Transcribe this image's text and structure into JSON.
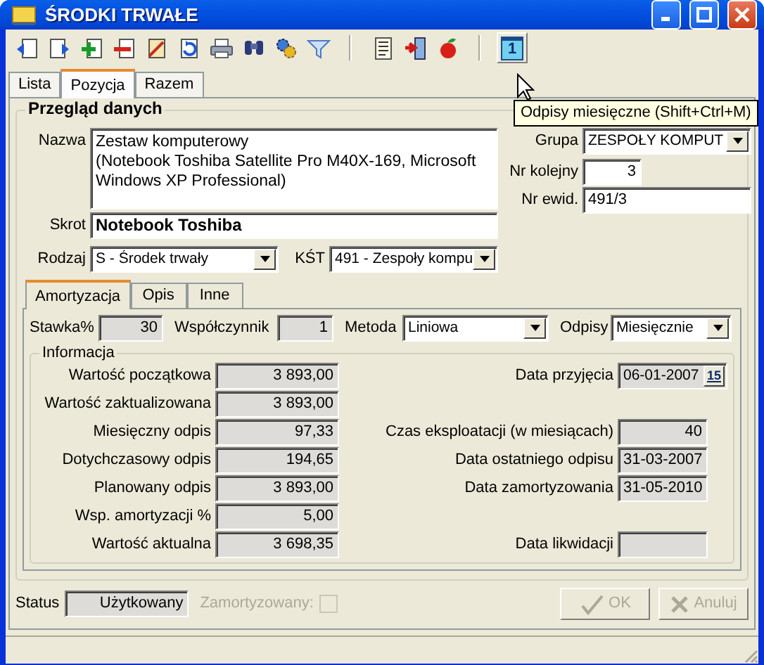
{
  "window": {
    "title": "ŚRODKI TRWAŁE"
  },
  "toolbar": {
    "groups": [
      [
        {
          "hot": false
        },
        {
          "hot": false
        },
        {
          "hot": false
        },
        {
          "hot": false
        },
        {
          "hot": false
        },
        {
          "hot": false
        },
        {
          "hot": false
        },
        {
          "hot": false
        },
        {
          "hot": false
        },
        {
          "hot": false
        }
      ],
      [
        {
          "hot": false
        },
        {
          "hot": false
        },
        {
          "hot": false
        }
      ],
      [
        {
          "hot": true,
          "label": "1"
        }
      ]
    ]
  },
  "tooltip": "Odpisy miesięczne (Shift+Ctrl+M)",
  "tabs": [
    {
      "label": "Lista",
      "selected": false
    },
    {
      "label": "Pozycja",
      "selected": true
    },
    {
      "label": "Razem",
      "selected": false
    }
  ],
  "overview": {
    "title": "Przegląd danych",
    "nazwa": {
      "label": "Nazwa",
      "value": "Zestaw komputerowy\n(Notebook Toshiba Satellite Pro M40X-169, Microsoft Windows XP Professional)"
    },
    "skrot": {
      "label": "Skrot",
      "value": "Notebook Toshiba"
    },
    "rodzaj": {
      "label": "Rodzaj",
      "value": "S - Środek trwały"
    },
    "kst": {
      "label": "KŚT",
      "value": "491 - Zespoły kompu"
    },
    "grupa": {
      "label": "Grupa",
      "value": "ZESPOŁY KOMPUT"
    },
    "nr_kolejny": {
      "label": "Nr kolejny",
      "value": "3"
    },
    "nr_ewid": {
      "label": "Nr ewid.",
      "value": "491/3"
    }
  },
  "subtabs": [
    {
      "label": "Amortyzacja",
      "selected": true
    },
    {
      "label": "Opis",
      "selected": false
    },
    {
      "label": "Inne",
      "selected": false
    }
  ],
  "params": [
    {
      "kind": "number",
      "label": "Stawka%",
      "value": "30"
    },
    {
      "kind": "number",
      "label": "Współczynnik",
      "value": "1"
    },
    {
      "kind": "combo",
      "label": "Metoda",
      "value": "Liniowa"
    },
    {
      "kind": "combo",
      "label": "Odpisy",
      "value": "Miesięcznie"
    }
  ],
  "info": {
    "title": "Informacja",
    "rows": [
      {
        "left": {
          "label": "Wartość początkowa",
          "value": "3 893,00"
        },
        "right": {
          "kind": "date",
          "label": "Data przyjęcia",
          "value": "06-01-2007",
          "button": "15"
        }
      },
      {
        "left": {
          "label": "Wartość zaktualizowana",
          "value": "3 893,00"
        }
      },
      {
        "left": {
          "label": "Miesięczny odpis",
          "value": "97,33"
        },
        "right": {
          "kind": "number",
          "label": "Czas eksploatacji (w miesiącach)",
          "value": "40"
        }
      },
      {
        "left": {
          "label": "Dotychczasowy odpis",
          "value": "194,65"
        },
        "right": {
          "kind": "text",
          "label": "Data ostatniego odpisu",
          "value": "31-03-2007"
        }
      },
      {
        "left": {
          "label": "Planowany odpis",
          "value": "3 893,00"
        },
        "right": {
          "kind": "text",
          "label": "Data zamortyzowania",
          "value": "31-05-2010"
        }
      },
      {
        "left": {
          "label": "Wsp. amortyzacji %",
          "value": "5,00"
        }
      },
      {
        "left": {
          "label": "Wartość aktualna",
          "value": "3 698,35"
        },
        "right": {
          "kind": "text",
          "label": "Data likwidacji"
        }
      }
    ]
  },
  "status": {
    "label": "Status",
    "value": "Użytkowany"
  },
  "amortized": {
    "label": "Zamortyzowany:",
    "checked": false,
    "disabled": true
  },
  "buttons": [
    {
      "kind": "ok",
      "label": "OK",
      "disabled": true
    },
    {
      "kind": "cancel",
      "label": "Anuluj",
      "disabled": true
    }
  ]
}
